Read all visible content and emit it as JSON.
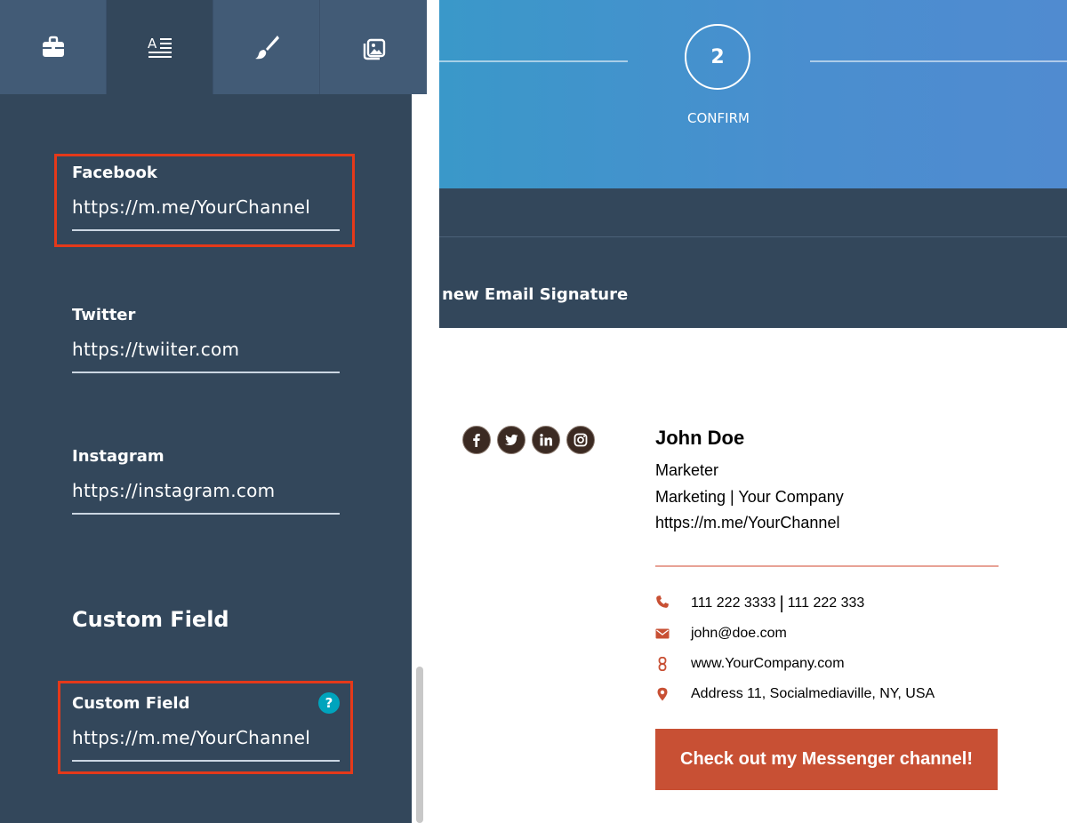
{
  "editor": {
    "tabs": [
      {
        "icon": "briefcase-icon"
      },
      {
        "icon": "text-format-icon"
      },
      {
        "icon": "paintbrush-icon"
      },
      {
        "icon": "image-gallery-icon"
      }
    ],
    "fields": {
      "facebook": {
        "label": "Facebook",
        "value": "https://m.me/YourChannel"
      },
      "twitter": {
        "label": "Twitter",
        "value": "https://twiiter.com"
      },
      "instagram": {
        "label": "Instagram",
        "value": "https://instagram.com"
      },
      "custom": {
        "label": "Custom Field",
        "value": "https://m.me/YourChannel",
        "help": "?"
      }
    },
    "section_title": "Custom Field"
  },
  "progress": {
    "step_number": "2",
    "step_label": "CONFIRM"
  },
  "header": {
    "title": "new Email Signature"
  },
  "signature": {
    "social": [
      "facebook-icon",
      "twitter-icon",
      "linkedin-icon",
      "instagram-icon"
    ],
    "name": "John Doe",
    "job_title": "Marketer",
    "department": "Marketing | Your Company",
    "custom_link": "https://m.me/YourChannel",
    "phone1": "111 222 3333",
    "phone_sep": "|",
    "phone2": "111 222 333",
    "email": "john@doe.com",
    "website": "www.YourCompany.com",
    "address": "Address 11, Socialmediaville, NY, USA",
    "cta": "Check out my Messenger channel!"
  },
  "colors": {
    "panel_bg": "#33475b",
    "tab_bg": "#425b76",
    "highlight": "#e5391a",
    "accent": "#c85034",
    "help_badge": "#00a4bd"
  }
}
